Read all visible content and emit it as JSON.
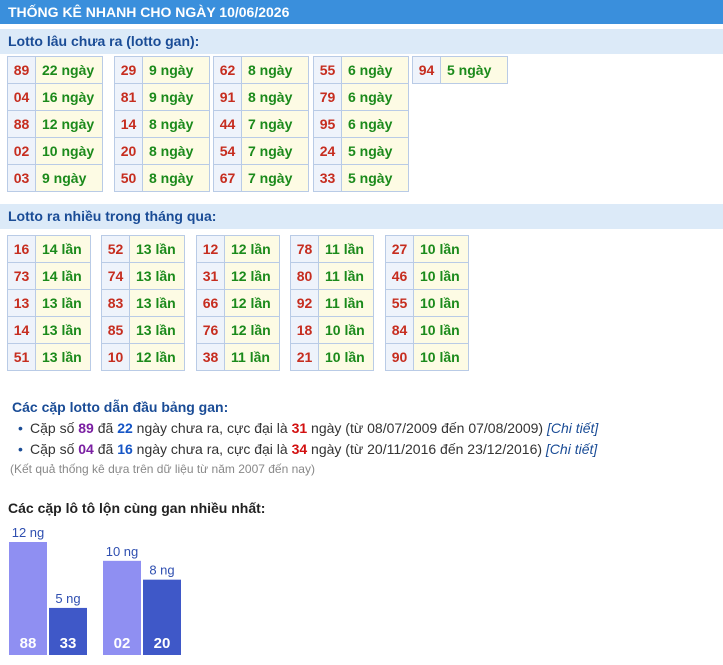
{
  "header": {
    "title": "THỐNG KÊ NHANH CHO NGÀY 10/06/2026"
  },
  "gan_section": {
    "title": "Lotto lâu chưa ra (lotto gan):",
    "columns": [
      [
        {
          "num": "89",
          "val": "22 ngày"
        },
        {
          "num": "04",
          "val": "16 ngày"
        },
        {
          "num": "88",
          "val": "12 ngày"
        },
        {
          "num": "02",
          "val": "10 ngày"
        },
        {
          "num": "03",
          "val": "9 ngày"
        }
      ],
      [
        {
          "num": "29",
          "val": "9 ngày"
        },
        {
          "num": "81",
          "val": "9 ngày"
        },
        {
          "num": "14",
          "val": "8 ngày"
        },
        {
          "num": "20",
          "val": "8 ngày"
        },
        {
          "num": "50",
          "val": "8 ngày"
        }
      ],
      [
        {
          "num": "62",
          "val": "8 ngày"
        },
        {
          "num": "91",
          "val": "8 ngày"
        },
        {
          "num": "44",
          "val": "7 ngày"
        },
        {
          "num": "54",
          "val": "7 ngày"
        },
        {
          "num": "67",
          "val": "7 ngày"
        }
      ],
      [
        {
          "num": "55",
          "val": "6 ngày"
        },
        {
          "num": "79",
          "val": "6 ngày"
        },
        {
          "num": "95",
          "val": "6 ngày"
        },
        {
          "num": "24",
          "val": "5 ngày"
        },
        {
          "num": "33",
          "val": "5 ngày"
        }
      ],
      [
        {
          "num": "94",
          "val": "5 ngày"
        }
      ]
    ]
  },
  "freq_section": {
    "title": "Lotto ra nhiều trong tháng qua:",
    "columns": [
      [
        {
          "num": "16",
          "val": "14 lần"
        },
        {
          "num": "73",
          "val": "14 lần"
        },
        {
          "num": "13",
          "val": "13 lần"
        },
        {
          "num": "14",
          "val": "13 lần"
        },
        {
          "num": "51",
          "val": "13 lần"
        }
      ],
      [
        {
          "num": "52",
          "val": "13 lần"
        },
        {
          "num": "74",
          "val": "13 lần"
        },
        {
          "num": "83",
          "val": "13 lần"
        },
        {
          "num": "85",
          "val": "13 lần"
        },
        {
          "num": "10",
          "val": "12 lần"
        }
      ],
      [
        {
          "num": "12",
          "val": "12 lần"
        },
        {
          "num": "31",
          "val": "12 lần"
        },
        {
          "num": "66",
          "val": "12 lần"
        },
        {
          "num": "76",
          "val": "12 lần"
        },
        {
          "num": "38",
          "val": "11 lần"
        }
      ],
      [
        {
          "num": "78",
          "val": "11 lần"
        },
        {
          "num": "80",
          "val": "11 lần"
        },
        {
          "num": "92",
          "val": "11 lần"
        },
        {
          "num": "18",
          "val": "10 lần"
        },
        {
          "num": "21",
          "val": "10 lần"
        }
      ],
      [
        {
          "num": "27",
          "val": "10 lần"
        },
        {
          "num": "46",
          "val": "10 lần"
        },
        {
          "num": "55",
          "val": "10 lần"
        },
        {
          "num": "84",
          "val": "10 lần"
        },
        {
          "num": "90",
          "val": "10 lần"
        }
      ]
    ]
  },
  "pairs_section": {
    "title": "Các cặp lotto dẫn đầu bảng gan:",
    "items": [
      {
        "p1": "Cặp số ",
        "pair": "89",
        "p2": " đã ",
        "days": "22",
        "p3": " ngày chưa ra, cực đại là ",
        "max": "31",
        "p4": " ngày (từ 08/07/2009 đến 07/08/2009) ",
        "link": "[Chi tiết]"
      },
      {
        "p1": "Cặp số ",
        "pair": "04",
        "p2": " đã ",
        "days": "16",
        "p3": " ngày chưa ra, cực đại là ",
        "max": "34",
        "p4": " ngày (từ 20/11/2016 đến 23/12/2016) ",
        "link": "[Chi tiết]"
      }
    ],
    "note": "(Kết quả thống kê dựa trên dữ liệu từ năm 2007 đến nay)"
  },
  "chart_section": {
    "title": "Các cặp lô tô lộn cùng gan nhiều nhất:"
  },
  "chart_data": {
    "type": "bar",
    "title": "Các cặp lô tô lộn cùng gan nhiều nhất:",
    "unit": "ng",
    "categories": [
      "88",
      "33",
      "02",
      "20"
    ],
    "values": [
      12,
      5,
      10,
      8
    ],
    "groups": [
      [
        "88",
        "33"
      ],
      [
        "02",
        "20"
      ]
    ],
    "colors": {
      "primary": "#8f8ff2",
      "secondary": "#3f58c8"
    },
    "ylim": [
      0,
      12
    ]
  }
}
